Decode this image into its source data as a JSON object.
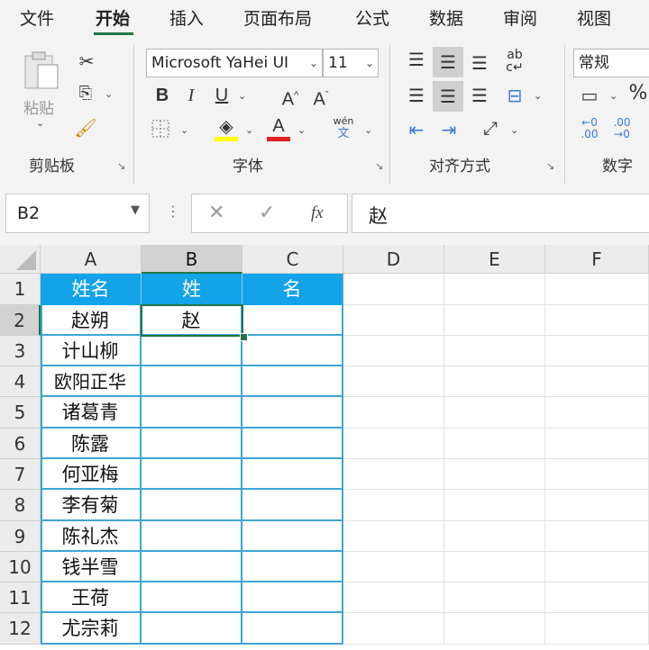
{
  "menu": {
    "tabs": [
      "文件",
      "开始",
      "插入",
      "页面布局",
      "公式",
      "数据",
      "审阅",
      "视图"
    ],
    "active": "开始"
  },
  "clipboard": {
    "paste_label": "粘贴",
    "group_label": "剪贴板"
  },
  "font": {
    "name": "Microsoft YaHei UI",
    "size": "11",
    "group_label": "字体",
    "grow": "A",
    "shrink": "A",
    "phonetic": "wén"
  },
  "alignment": {
    "group_label": "对齐方式"
  },
  "number": {
    "format": "常规",
    "group_label": "数字",
    "percent": "%"
  },
  "formula_bar": {
    "name_box": "B2",
    "fx": "fx",
    "value": "赵"
  },
  "columns": [
    "A",
    "B",
    "C",
    "D",
    "E",
    "F"
  ],
  "rows": [
    "1",
    "2",
    "3",
    "4",
    "5",
    "6",
    "7",
    "8",
    "9",
    "10",
    "11",
    "12"
  ],
  "table": {
    "headers": [
      "姓名",
      "姓",
      "名"
    ],
    "names": [
      "赵朔",
      "计山柳",
      "欧阳正华",
      "诸葛青",
      "陈露",
      "何亚梅",
      "李有菊",
      "陈礼杰",
      "钱半雪",
      "王荷",
      "尤宗莉"
    ],
    "b2": "赵"
  },
  "colors": {
    "accent": "#217346",
    "header_fill": "#13a3e8",
    "table_border": "#3ea6d6",
    "font_color_red": "#e02020",
    "highlight_yellow": "#ffff00"
  }
}
